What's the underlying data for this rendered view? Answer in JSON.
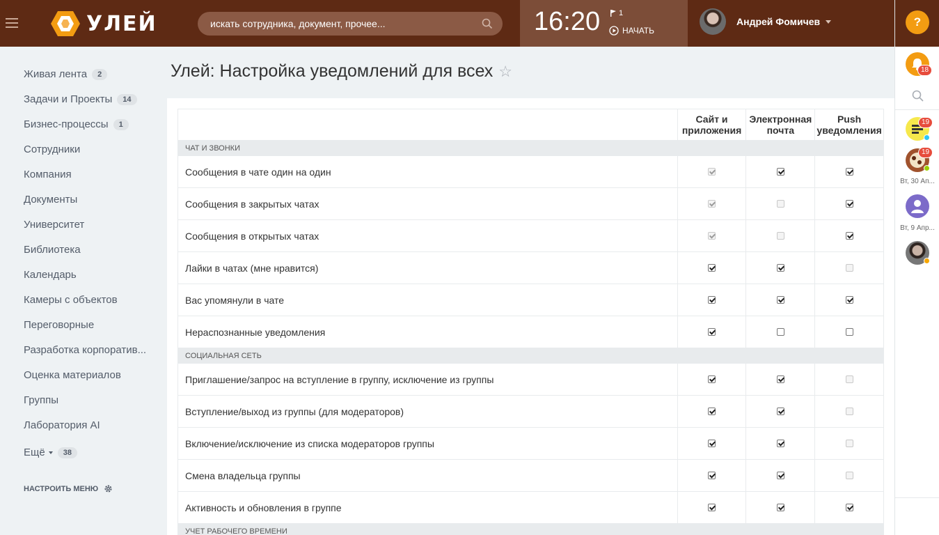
{
  "header": {
    "logo_text": "УЛЕЙ",
    "search_placeholder": "искать сотрудника, документ, прочее...",
    "clock": "16:20",
    "flag_count": "1",
    "start_label": "НАЧАТЬ",
    "user_name": "Андрей Фомичев"
  },
  "rightbar": {
    "help": "?",
    "notif_badge": "18",
    "chats": [
      {
        "badge": "19",
        "date": ""
      },
      {
        "badge": "19",
        "date": "Вт, 30 Ап..."
      },
      {
        "badge": "",
        "date": "Вт, 9 Апр..."
      },
      {
        "badge": "",
        "date": ""
      }
    ]
  },
  "nav": {
    "items": [
      {
        "label": "Живая лента",
        "count": "2"
      },
      {
        "label": "Задачи и Проекты",
        "count": "14"
      },
      {
        "label": "Бизнес-процессы",
        "count": "1"
      },
      {
        "label": "Сотрудники",
        "count": ""
      },
      {
        "label": "Компания",
        "count": ""
      },
      {
        "label": "Документы",
        "count": ""
      },
      {
        "label": "Университет",
        "count": ""
      },
      {
        "label": "Библиотека",
        "count": ""
      },
      {
        "label": "Календарь",
        "count": ""
      },
      {
        "label": "Камеры с объектов",
        "count": ""
      },
      {
        "label": "Переговорные",
        "count": ""
      },
      {
        "label": "Разработка корпоратив...",
        "count": ""
      },
      {
        "label": "Оценка материалов",
        "count": ""
      },
      {
        "label": "Группы",
        "count": ""
      },
      {
        "label": "Лаборатория AI",
        "count": ""
      },
      {
        "label": "Ещё",
        "count": "38"
      }
    ],
    "setup_label": "НАСТРОИТЬ МЕНЮ"
  },
  "page": {
    "title": "Улей: Настройка уведомлений для всех",
    "columns": [
      "Сайт и приложения",
      "Электронная почта",
      "Push уведомления"
    ]
  },
  "groups": [
    {
      "name": "ЧАТ И ЗВОНКИ",
      "rows": [
        {
          "label": "Сообщения в чате один на один",
          "site": {
            "checked": true,
            "disabled": true
          },
          "email": {
            "checked": true,
            "disabled": false
          },
          "push": {
            "checked": true,
            "disabled": false
          }
        },
        {
          "label": "Сообщения в закрытых чатах",
          "site": {
            "checked": true,
            "disabled": true
          },
          "email": {
            "checked": false,
            "disabled": true
          },
          "push": {
            "checked": true,
            "disabled": false
          }
        },
        {
          "label": "Сообщения в открытых чатах",
          "site": {
            "checked": true,
            "disabled": true
          },
          "email": {
            "checked": false,
            "disabled": true
          },
          "push": {
            "checked": true,
            "disabled": false
          }
        },
        {
          "label": "Лайки в чатах (мне нравится)",
          "site": {
            "checked": true,
            "disabled": false
          },
          "email": {
            "checked": true,
            "disabled": false
          },
          "push": {
            "checked": false,
            "disabled": true
          }
        },
        {
          "label": "Вас упомянули в чате",
          "site": {
            "checked": true,
            "disabled": false
          },
          "email": {
            "checked": true,
            "disabled": false
          },
          "push": {
            "checked": true,
            "disabled": false
          }
        },
        {
          "label": "Нераспознанные уведомления",
          "site": {
            "checked": true,
            "disabled": false
          },
          "email": {
            "checked": false,
            "disabled": false
          },
          "push": {
            "checked": false,
            "disabled": false
          }
        }
      ]
    },
    {
      "name": "СОЦИАЛЬНАЯ СЕТЬ",
      "rows": [
        {
          "label": "Приглашение/запрос на вступление в группу, исключение из группы",
          "site": {
            "checked": true,
            "disabled": false
          },
          "email": {
            "checked": true,
            "disabled": false
          },
          "push": {
            "checked": false,
            "disabled": true
          }
        },
        {
          "label": "Вступление/выход из группы (для модераторов)",
          "site": {
            "checked": true,
            "disabled": false
          },
          "email": {
            "checked": true,
            "disabled": false
          },
          "push": {
            "checked": false,
            "disabled": true
          }
        },
        {
          "label": "Включение/исключение из списка модераторов группы",
          "site": {
            "checked": true,
            "disabled": false
          },
          "email": {
            "checked": true,
            "disabled": false
          },
          "push": {
            "checked": false,
            "disabled": true
          }
        },
        {
          "label": "Смена владельца группы",
          "site": {
            "checked": true,
            "disabled": false
          },
          "email": {
            "checked": true,
            "disabled": false
          },
          "push": {
            "checked": false,
            "disabled": true
          }
        },
        {
          "label": "Активность и обновления в группе",
          "site": {
            "checked": true,
            "disabled": false
          },
          "email": {
            "checked": true,
            "disabled": false
          },
          "push": {
            "checked": true,
            "disabled": false
          }
        }
      ]
    },
    {
      "name": "УЧЕТ РАБОЧЕГО ВРЕМЕНИ",
      "rows": []
    }
  ]
}
